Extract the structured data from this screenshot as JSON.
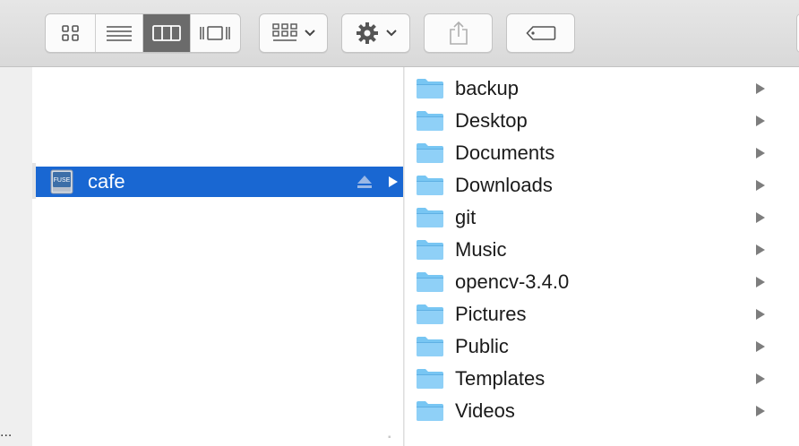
{
  "toolbar": {
    "view_modes": [
      {
        "icon": "icon-view-icon",
        "active": false
      },
      {
        "icon": "list-view-icon",
        "active": false
      },
      {
        "icon": "column-view-icon",
        "active": true
      },
      {
        "icon": "cover-flow-icon",
        "active": false
      }
    ],
    "arrange_icon": "grid-arrange-icon",
    "action_icon": "gear-icon",
    "share_icon": "share-icon",
    "tag_icon": "tag-icon"
  },
  "column1": {
    "selected_item": {
      "label": "cafe",
      "icon": "fuse-drive-icon",
      "badge": "FUSE"
    }
  },
  "column2": {
    "items": [
      {
        "label": "backup"
      },
      {
        "label": "Desktop"
      },
      {
        "label": "Documents"
      },
      {
        "label": "Downloads"
      },
      {
        "label": "git"
      },
      {
        "label": "Music"
      },
      {
        "label": "opencv-3.4.0"
      },
      {
        "label": "Pictures"
      },
      {
        "label": "Public"
      },
      {
        "label": "Templates"
      },
      {
        "label": "Videos"
      }
    ]
  },
  "sidebar": {
    "overflow": "..."
  },
  "colors": {
    "selection": "#1967d2",
    "folder": "#78c6f3",
    "toolbar_active": "#6b6b6b"
  }
}
